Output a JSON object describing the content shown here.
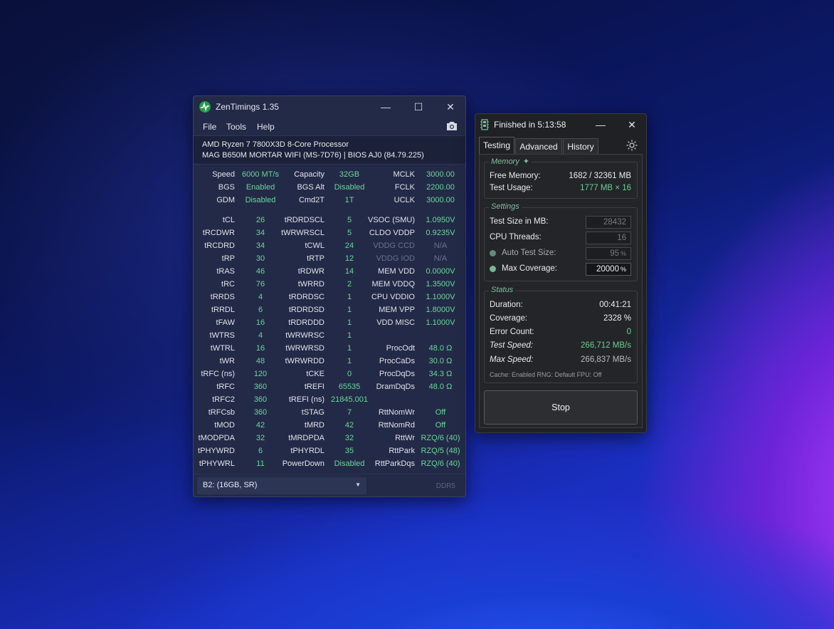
{
  "zentimings": {
    "title": "ZenTimings 1.35",
    "menu": [
      "File",
      "Tools",
      "Help"
    ],
    "cpu": "AMD Ryzen 7 7800X3D 8-Core Processor",
    "board": "MAG B650M MORTAR WIFI (MS-7D76) | BIOS AJ0 (84.79.225)",
    "top_rows": [
      [
        "Speed",
        "6000 MT/s",
        "Capacity",
        "32GB",
        "MCLK",
        "3000.00"
      ],
      [
        "BGS",
        "Enabled",
        "BGS Alt",
        "Disabled",
        "FCLK",
        "2200.00"
      ],
      [
        "GDM",
        "Disabled",
        "Cmd2T",
        "1T",
        "UCLK",
        "3000.00"
      ]
    ],
    "timing_rows": [
      [
        "tCL",
        "26",
        "tRDRDSCL",
        "5",
        "VSOC (SMU)",
        "1.0950V"
      ],
      [
        "tRCDWR",
        "34",
        "tWRWRSCL",
        "5",
        "CLDO VDDP",
        "0.9235V"
      ],
      [
        "tRCDRD",
        "34",
        "tCWL",
        "24",
        "VDDG CCD",
        "N/A"
      ],
      [
        "tRP",
        "30",
        "tRTP",
        "12",
        "VDDG IOD",
        "N/A"
      ],
      [
        "tRAS",
        "46",
        "tRDWR",
        "14",
        "MEM VDD",
        "0.0000V"
      ],
      [
        "tRC",
        "76",
        "tWRRD",
        "2",
        "MEM VDDQ",
        "1.3500V"
      ],
      [
        "tRRDS",
        "4",
        "tRDRDSC",
        "1",
        "CPU VDDIO",
        "1.1000V"
      ],
      [
        "tRRDL",
        "6",
        "tRDRDSD",
        "1",
        "MEM VPP",
        "1.8000V"
      ],
      [
        "tFAW",
        "16",
        "tRDRDDD",
        "1",
        "VDD MISC",
        "1.1000V"
      ],
      [
        "tWTRS",
        "4",
        "tWRWRSC",
        "1",
        "",
        ""
      ],
      [
        "tWTRL",
        "16",
        "tWRWRSD",
        "1",
        "ProcOdt",
        "48.0 Ω"
      ],
      [
        "tWR",
        "48",
        "tWRWRDD",
        "1",
        "ProcCaDs",
        "30.0 Ω"
      ],
      [
        "tRFC (ns)",
        "120",
        "tCKE",
        "0",
        "ProcDqDs",
        "34.3 Ω"
      ],
      [
        "tRFC",
        "360",
        "tREFI",
        "65535",
        "DramDqDs",
        "48.0 Ω"
      ],
      [
        "tRFC2",
        "360",
        "tREFI (ns)",
        "21845.001",
        "",
        ""
      ],
      [
        "tRFCsb",
        "360",
        "tSTAG",
        "7",
        "RttNomWr",
        "Off"
      ],
      [
        "tMOD",
        "42",
        "tMRD",
        "42",
        "RttNomRd",
        "Off"
      ],
      [
        "tMODPDA",
        "32",
        "tMRDPDA",
        "32",
        "RttWr",
        "RZQ/6 (40)"
      ],
      [
        "tPHYWRD",
        "6",
        "tPHYRDL",
        "35",
        "RttPark",
        "RZQ/5 (48)"
      ],
      [
        "tPHYWRL",
        "11",
        "PowerDown",
        "Disabled",
        "RttParkDqs",
        "RZQ/6 (40)"
      ]
    ],
    "dimm": "B2:  (16GB, SR)",
    "mem_type": "DDR5"
  },
  "testmem": {
    "title": "Finished in 5:13:58",
    "tabs": [
      "Testing",
      "Advanced",
      "History"
    ],
    "memory_group": "Memory",
    "free_memory_label": "Free Memory:",
    "free_memory_value": "1682 / 32361 MB",
    "test_usage_label": "Test Usage:",
    "test_usage_value": "1777 MB × 16",
    "settings_group": "Settings",
    "test_size_label": "Test Size in MB:",
    "test_size_value": "28432",
    "cpu_threads_label": "CPU Threads:",
    "cpu_threads_value": "16",
    "auto_test_label": "Auto Test Size:",
    "auto_test_value": "95",
    "max_cov_label": "Max Coverage:",
    "max_cov_value": "20000",
    "pct": "%",
    "status_group": "Status",
    "duration_label": "Duration:",
    "duration_value": "00:41:21",
    "coverage_label": "Coverage:",
    "coverage_value": "2328 %",
    "errors_label": "Error Count:",
    "errors_value": "0",
    "test_speed_label": "Test Speed:",
    "test_speed_value": "266,712 MB/s",
    "max_speed_label": "Max Speed:",
    "max_speed_value": "266,837 MB/s",
    "footer_info": "Cache: Enabled  RNG: Default  FPU: Off",
    "stop": "Stop"
  },
  "colors": {
    "accent_green": "#6ad79a",
    "zt_bg": "#232a47",
    "tm_bg": "#1f2124"
  }
}
